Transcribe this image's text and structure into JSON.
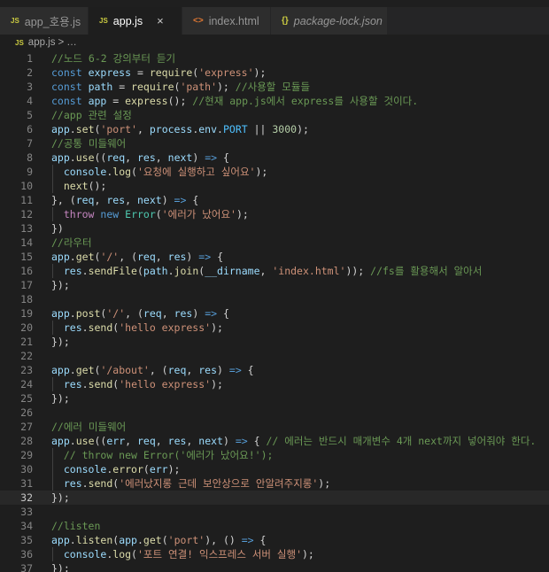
{
  "tabs": [
    {
      "label": "app_호용.js",
      "icon": "js-file-icon",
      "icon_text": "JS",
      "active": false,
      "italic": false
    },
    {
      "label": "app.js",
      "icon": "js-file-icon",
      "icon_text": "JS",
      "active": true,
      "italic": false,
      "close_glyph": "×"
    },
    {
      "label": "index.html",
      "icon": "html-file-icon",
      "icon_text": "<>",
      "active": false,
      "italic": false
    },
    {
      "label": "package-lock.json",
      "icon": "json-file-icon",
      "icon_text": "{}",
      "active": false,
      "italic": true
    }
  ],
  "breadcrumb": {
    "icon_text": "JS",
    "file": "app.js",
    "separator": ">",
    "tail": "…"
  },
  "editor": {
    "current_line": 32,
    "lines": [
      {
        "n": "1",
        "tokens": [
          [
            "com",
            "//노드 6-2 강의부터 듣기"
          ]
        ]
      },
      {
        "n": "2",
        "tokens": [
          [
            "key",
            "const"
          ],
          [
            "txt",
            " "
          ],
          [
            "var",
            "express"
          ],
          [
            "txt",
            " = "
          ],
          [
            "fn",
            "require"
          ],
          [
            "txt",
            "("
          ],
          [
            "str",
            "'express'"
          ],
          [
            "txt",
            ");"
          ]
        ]
      },
      {
        "n": "3",
        "tokens": [
          [
            "key",
            "const"
          ],
          [
            "txt",
            " "
          ],
          [
            "var",
            "path"
          ],
          [
            "txt",
            " = "
          ],
          [
            "fn",
            "require"
          ],
          [
            "txt",
            "("
          ],
          [
            "str",
            "'path'"
          ],
          [
            "txt",
            "); "
          ],
          [
            "com",
            "//사용할 모듈들"
          ]
        ]
      },
      {
        "n": "4",
        "tokens": [
          [
            "key",
            "const"
          ],
          [
            "txt",
            " "
          ],
          [
            "var",
            "app"
          ],
          [
            "txt",
            " = "
          ],
          [
            "fn",
            "express"
          ],
          [
            "txt",
            "(); "
          ],
          [
            "com",
            "//현재 app.js에서 express를 사용할 것이다."
          ]
        ]
      },
      {
        "n": "5",
        "tokens": [
          [
            "com",
            "//app 관련 설정"
          ]
        ]
      },
      {
        "n": "6",
        "tokens": [
          [
            "var",
            "app"
          ],
          [
            "txt",
            "."
          ],
          [
            "fn",
            "set"
          ],
          [
            "txt",
            "("
          ],
          [
            "str",
            "'port'"
          ],
          [
            "txt",
            ", "
          ],
          [
            "var",
            "process"
          ],
          [
            "txt",
            "."
          ],
          [
            "var",
            "env"
          ],
          [
            "txt",
            "."
          ],
          [
            "con",
            "PORT"
          ],
          [
            "txt",
            " || "
          ],
          [
            "num",
            "3000"
          ],
          [
            "txt",
            ");"
          ]
        ]
      },
      {
        "n": "7",
        "tokens": [
          [
            "com",
            "//공통 미들웨어"
          ]
        ]
      },
      {
        "n": "8",
        "tokens": [
          [
            "var",
            "app"
          ],
          [
            "txt",
            "."
          ],
          [
            "fn",
            "use"
          ],
          [
            "txt",
            "(("
          ],
          [
            "var",
            "req"
          ],
          [
            "txt",
            ", "
          ],
          [
            "var",
            "res"
          ],
          [
            "txt",
            ", "
          ],
          [
            "var",
            "next"
          ],
          [
            "txt",
            ") "
          ],
          [
            "key",
            "=>"
          ],
          [
            "txt",
            " {"
          ]
        ]
      },
      {
        "n": "9",
        "tokens": [
          [
            "txt",
            "  "
          ],
          [
            "var",
            "console"
          ],
          [
            "txt",
            "."
          ],
          [
            "fn",
            "log"
          ],
          [
            "txt",
            "("
          ],
          [
            "str",
            "'요청에 실행하고 싶어요'"
          ],
          [
            "txt",
            ");"
          ]
        ]
      },
      {
        "n": "10",
        "tokens": [
          [
            "txt",
            "  "
          ],
          [
            "fn",
            "next"
          ],
          [
            "txt",
            "();"
          ]
        ]
      },
      {
        "n": "11",
        "tokens": [
          [
            "txt",
            "}, ("
          ],
          [
            "var",
            "req"
          ],
          [
            "txt",
            ", "
          ],
          [
            "var",
            "res"
          ],
          [
            "txt",
            ", "
          ],
          [
            "var",
            "next"
          ],
          [
            "txt",
            ") "
          ],
          [
            "key",
            "=>"
          ],
          [
            "txt",
            " {"
          ]
        ]
      },
      {
        "n": "12",
        "tokens": [
          [
            "txt",
            "  "
          ],
          [
            "ctl",
            "throw"
          ],
          [
            "txt",
            " "
          ],
          [
            "key",
            "new"
          ],
          [
            "txt",
            " "
          ],
          [
            "cls",
            "Error"
          ],
          [
            "txt",
            "("
          ],
          [
            "str",
            "'에러가 났어요'"
          ],
          [
            "txt",
            ");"
          ]
        ]
      },
      {
        "n": "13",
        "tokens": [
          [
            "txt",
            "})"
          ]
        ]
      },
      {
        "n": "14",
        "tokens": [
          [
            "com",
            "//라우터"
          ]
        ]
      },
      {
        "n": "15",
        "tokens": [
          [
            "var",
            "app"
          ],
          [
            "txt",
            "."
          ],
          [
            "fn",
            "get"
          ],
          [
            "txt",
            "("
          ],
          [
            "str",
            "'/'"
          ],
          [
            "txt",
            ", ("
          ],
          [
            "var",
            "req"
          ],
          [
            "txt",
            ", "
          ],
          [
            "var",
            "res"
          ],
          [
            "txt",
            ") "
          ],
          [
            "key",
            "=>"
          ],
          [
            "txt",
            " {"
          ]
        ]
      },
      {
        "n": "16",
        "tokens": [
          [
            "txt",
            "  "
          ],
          [
            "var",
            "res"
          ],
          [
            "txt",
            "."
          ],
          [
            "fn",
            "sendFile"
          ],
          [
            "txt",
            "("
          ],
          [
            "var",
            "path"
          ],
          [
            "txt",
            "."
          ],
          [
            "fn",
            "join"
          ],
          [
            "txt",
            "("
          ],
          [
            "var",
            "__dirname"
          ],
          [
            "txt",
            ", "
          ],
          [
            "str",
            "'index.html'"
          ],
          [
            "txt",
            ")); "
          ],
          [
            "com",
            "//fs를 활용해서 알아서"
          ]
        ]
      },
      {
        "n": "17",
        "tokens": [
          [
            "txt",
            "});"
          ]
        ]
      },
      {
        "n": "18",
        "tokens": []
      },
      {
        "n": "19",
        "tokens": [
          [
            "var",
            "app"
          ],
          [
            "txt",
            "."
          ],
          [
            "fn",
            "post"
          ],
          [
            "txt",
            "("
          ],
          [
            "str",
            "'/'"
          ],
          [
            "txt",
            ", ("
          ],
          [
            "var",
            "req"
          ],
          [
            "txt",
            ", "
          ],
          [
            "var",
            "res"
          ],
          [
            "txt",
            ") "
          ],
          [
            "key",
            "=>"
          ],
          [
            "txt",
            " {"
          ]
        ]
      },
      {
        "n": "20",
        "tokens": [
          [
            "txt",
            "  "
          ],
          [
            "var",
            "res"
          ],
          [
            "txt",
            "."
          ],
          [
            "fn",
            "send"
          ],
          [
            "txt",
            "("
          ],
          [
            "str",
            "'hello express'"
          ],
          [
            "txt",
            ");"
          ]
        ]
      },
      {
        "n": "21",
        "tokens": [
          [
            "txt",
            "});"
          ]
        ]
      },
      {
        "n": "22",
        "tokens": []
      },
      {
        "n": "23",
        "tokens": [
          [
            "var",
            "app"
          ],
          [
            "txt",
            "."
          ],
          [
            "fn",
            "get"
          ],
          [
            "txt",
            "("
          ],
          [
            "str",
            "'/about'"
          ],
          [
            "txt",
            ", ("
          ],
          [
            "var",
            "req"
          ],
          [
            "txt",
            ", "
          ],
          [
            "var",
            "res"
          ],
          [
            "txt",
            ") "
          ],
          [
            "key",
            "=>"
          ],
          [
            "txt",
            " {"
          ]
        ]
      },
      {
        "n": "24",
        "tokens": [
          [
            "txt",
            "  "
          ],
          [
            "var",
            "res"
          ],
          [
            "txt",
            "."
          ],
          [
            "fn",
            "send"
          ],
          [
            "txt",
            "("
          ],
          [
            "str",
            "'hello express'"
          ],
          [
            "txt",
            ");"
          ]
        ]
      },
      {
        "n": "25",
        "tokens": [
          [
            "txt",
            "});"
          ]
        ]
      },
      {
        "n": "26",
        "tokens": []
      },
      {
        "n": "27",
        "tokens": [
          [
            "com",
            "//에러 미들웨어"
          ]
        ]
      },
      {
        "n": "28",
        "tokens": [
          [
            "var",
            "app"
          ],
          [
            "txt",
            "."
          ],
          [
            "fn",
            "use"
          ],
          [
            "txt",
            "(("
          ],
          [
            "var",
            "err"
          ],
          [
            "txt",
            ", "
          ],
          [
            "var",
            "req"
          ],
          [
            "txt",
            ", "
          ],
          [
            "var",
            "res"
          ],
          [
            "txt",
            ", "
          ],
          [
            "var",
            "next"
          ],
          [
            "txt",
            ") "
          ],
          [
            "key",
            "=>"
          ],
          [
            "txt",
            " { "
          ],
          [
            "com",
            "// 에러는 반드시 매개변수 4개 next까지 넣어줘야 한다."
          ]
        ]
      },
      {
        "n": "29",
        "tokens": [
          [
            "txt",
            "  "
          ],
          [
            "com",
            "// throw new Error('에러가 났어요!');"
          ]
        ]
      },
      {
        "n": "30",
        "tokens": [
          [
            "txt",
            "  "
          ],
          [
            "var",
            "console"
          ],
          [
            "txt",
            "."
          ],
          [
            "fn",
            "error"
          ],
          [
            "txt",
            "("
          ],
          [
            "var",
            "err"
          ],
          [
            "txt",
            ");"
          ]
        ]
      },
      {
        "n": "31",
        "tokens": [
          [
            "txt",
            "  "
          ],
          [
            "var",
            "res"
          ],
          [
            "txt",
            "."
          ],
          [
            "fn",
            "send"
          ],
          [
            "txt",
            "("
          ],
          [
            "str",
            "'에러났지롱 근데 보안상으로 안알려주지롱'"
          ],
          [
            "txt",
            ");"
          ]
        ]
      },
      {
        "n": "32",
        "tokens": [
          [
            "txt",
            "});"
          ]
        ]
      },
      {
        "n": "33",
        "tokens": []
      },
      {
        "n": "34",
        "tokens": [
          [
            "com",
            "//listen"
          ]
        ]
      },
      {
        "n": "35",
        "tokens": [
          [
            "var",
            "app"
          ],
          [
            "txt",
            "."
          ],
          [
            "fn",
            "listen"
          ],
          [
            "txt",
            "("
          ],
          [
            "var",
            "app"
          ],
          [
            "txt",
            "."
          ],
          [
            "fn",
            "get"
          ],
          [
            "txt",
            "("
          ],
          [
            "str",
            "'port'"
          ],
          [
            "txt",
            "), () "
          ],
          [
            "key",
            "=>"
          ],
          [
            "txt",
            " {"
          ]
        ]
      },
      {
        "n": "36",
        "tokens": [
          [
            "txt",
            "  "
          ],
          [
            "var",
            "console"
          ],
          [
            "txt",
            "."
          ],
          [
            "fn",
            "log"
          ],
          [
            "txt",
            "("
          ],
          [
            "str",
            "'포트 연결! 익스프레스 서버 실행'"
          ],
          [
            "txt",
            ");"
          ]
        ]
      },
      {
        "n": "37",
        "tokens": [
          [
            "txt",
            "});"
          ]
        ]
      }
    ]
  }
}
